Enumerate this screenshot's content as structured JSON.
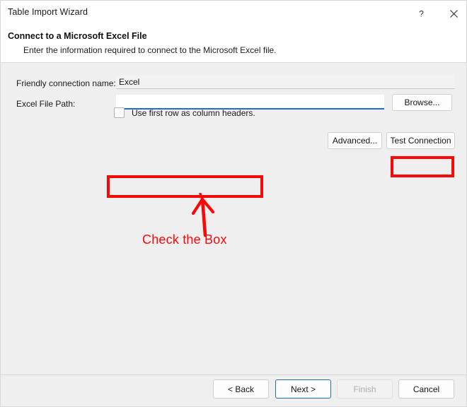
{
  "window": {
    "title": "Table Import Wizard",
    "help_icon": "question-mark-icon",
    "close_icon": "close-icon"
  },
  "header": {
    "title": "Connect to a Microsoft Excel File",
    "subtitle": "Enter the information required to connect to the Microsoft Excel file."
  },
  "form": {
    "friendly_name_label": "Friendly connection name:",
    "friendly_name_value": "Excel",
    "friendly_name_placeholder": "",
    "file_path_label": "Excel File Path:",
    "file_path_value": "",
    "file_path_placeholder": "",
    "browse_label": "Browse...",
    "checkbox_label": "Use first row as column headers.",
    "checkbox_checked": "false",
    "advanced_label": "Advanced...",
    "test_connection_label": "Test Connection"
  },
  "annotation": {
    "text": "Check the Box",
    "color": "#fb0707",
    "arrow_direction": "up",
    "highlight_targets": [
      "browse-button",
      "use-first-row-checkbox"
    ]
  },
  "footer": {
    "back_label": "< Back",
    "next_label": "Next >",
    "finish_label": "Finish",
    "finish_disabled": "true",
    "cancel_label": "Cancel"
  },
  "colors": {
    "dialog_background": "#efefef",
    "panel_background": "#ffffff",
    "focus_accent": "#1f6fc4",
    "annotation_red": "#fb0707",
    "disabled_text": "#adadad"
  }
}
